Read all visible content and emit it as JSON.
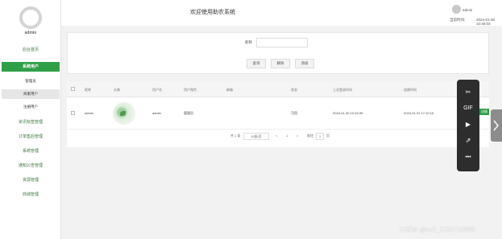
{
  "sidebar": {
    "user": "admin",
    "items": [
      {
        "label": "后台首页",
        "active": false
      },
      {
        "label": "系统用户",
        "active": true
      },
      {
        "label": "管理员",
        "sub": true
      },
      {
        "label": "商家用户",
        "sub": true,
        "hover": true
      },
      {
        "label": "注册用户",
        "sub": true
      },
      {
        "label": "资讯标签管理"
      },
      {
        "label": "订单售后管理"
      },
      {
        "label": "系统管理"
      },
      {
        "label": "通知公告管理"
      },
      {
        "label": "资源管理"
      },
      {
        "label": "商城管理"
      }
    ]
  },
  "header": {
    "title": "欢迎使用助农系统",
    "admin_name": "admin",
    "time_label": "当前时间:",
    "time_value": "2024-01-30 10:46:03"
  },
  "search": {
    "label": "昵称",
    "placeholder": "",
    "buttons": [
      "查询",
      "删除",
      "添加"
    ]
  },
  "table": {
    "headers": [
      "昵称",
      "头像",
      "用户名",
      "用户角色",
      "邮箱",
      "状态",
      "上次登录时间",
      "创建时间"
    ],
    "rows": [
      {
        "nickname": "admin",
        "username": "admin",
        "role": "管理员",
        "email": "",
        "status": "可用",
        "last_login": "2024-01-30 10:15:39",
        "created": "2024-01-31 17:10:15"
      }
    ]
  },
  "pager": {
    "total": "共 1 条",
    "page_size": "10条/页",
    "prev": "<",
    "page": "1",
    "next": ">",
    "goto_label": "前往",
    "goto_value": "1",
    "page_unit": "页"
  },
  "toolbar": {
    "icons": [
      "scissors-icon",
      "gif-icon",
      "play-icon",
      "export-icon",
      "more-icon"
    ],
    "gif": "GIF",
    "more": "•••"
  },
  "tag": "详情",
  "watermark": "CSDN @vx2_CXKF10088"
}
